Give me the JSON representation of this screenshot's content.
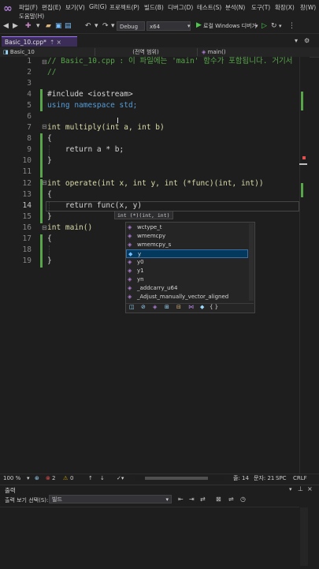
{
  "menu": {
    "items": [
      "파일(F)",
      "편집(E)",
      "보기(V)",
      "Git(G)",
      "프로젝트(P)",
      "빌드(B)",
      "디버그(D)",
      "테스트(S)",
      "분석(N)",
      "도구(T)",
      "확장(X)",
      "창(W)"
    ],
    "help": "도움말(H)"
  },
  "toolbar": {
    "config": "Debug",
    "platform": "x64",
    "run_label": "로컬 Windows 디버거"
  },
  "tabs": [
    {
      "label": "Basic_10.cpp*",
      "pin": "⇡ ×"
    }
  ],
  "navbar": {
    "project": "Basic_10",
    "scope": "(전역 범위)",
    "member": "main()"
  },
  "editor": {
    "lines": [
      {
        "n": "1",
        "code": "// Basic_10.cpp : 이 파일에는 'main' 함수가 포함됩니다. 거기서"
      },
      {
        "n": "2",
        "code": "//"
      },
      {
        "n": "3",
        "code": ""
      },
      {
        "n": "4",
        "code": "#include <iostream>"
      },
      {
        "n": "5",
        "code": "using namespace std;"
      },
      {
        "n": "6",
        "code": ""
      },
      {
        "n": "7",
        "code": "int multiply(int a, int b)"
      },
      {
        "n": "8",
        "code": "{"
      },
      {
        "n": "9",
        "code": "    return a * b;"
      },
      {
        "n": "10",
        "code": "}"
      },
      {
        "n": "11",
        "code": ""
      },
      {
        "n": "12",
        "code": "int operate(int x, int y, int (*func)(int, int))"
      },
      {
        "n": "13",
        "code": "{"
      },
      {
        "n": "14",
        "code": "    return func(x, y)"
      },
      {
        "n": "15",
        "code": "}"
      },
      {
        "n": "16",
        "code": "int main()"
      },
      {
        "n": "17",
        "code": "{"
      },
      {
        "n": "18",
        "code": ""
      },
      {
        "n": "19",
        "code": "}"
      }
    ],
    "param_tip": "int (*)(int, int)"
  },
  "completion": {
    "items": [
      "wctype_t",
      "wmemcpy",
      "wmemcpy_s",
      "y",
      "y0",
      "y1",
      "yn",
      "_addcarry_u64",
      "_Adjust_manually_vector_aligned"
    ],
    "selected_index": 3,
    "filters": [
      "◫",
      "⊘",
      "◈",
      "⊞",
      "⊟",
      "⋈",
      "◆",
      "{ }"
    ]
  },
  "status": {
    "zoom": "100 %",
    "errors": "2",
    "warnings": "0",
    "line": "줄: 14",
    "col": "문자: 21",
    "spc": "SPC",
    "crlf": "CRLF"
  },
  "output": {
    "title": "출력",
    "source_label": "출력 보기 선택(S):",
    "source_value": "빌드"
  },
  "colors": {
    "accent": "#a277ff",
    "keyword": "#569cd6",
    "comment": "#57a64a",
    "function": "#dcdcaa"
  }
}
